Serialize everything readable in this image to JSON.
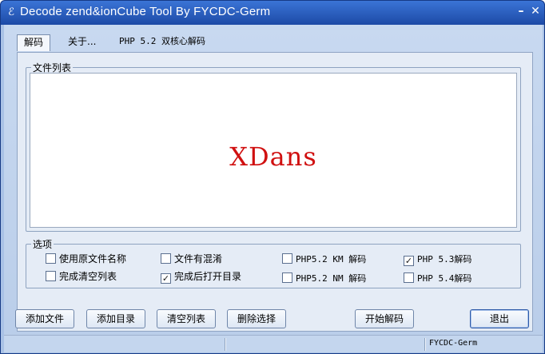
{
  "window": {
    "title": "Decode zend&ionCube Tool By FYCDC-Germ",
    "icon": "app-icon",
    "min_glyph": "–",
    "close_glyph": "✕"
  },
  "tabs": [
    {
      "label": "解码",
      "active": true
    },
    {
      "label": "关于..."
    },
    {
      "label": "PHP 5.2 双核心解码"
    }
  ],
  "file_list": {
    "legend": "文件列表",
    "watermark": "XDans"
  },
  "options": {
    "legend": "选项",
    "items": [
      {
        "label": "使用原文件名称",
        "checked": false
      },
      {
        "label": "完成清空列表",
        "checked": false
      },
      {
        "label": "文件有混淆",
        "checked": false
      },
      {
        "label": "完成后打开目录",
        "checked": true
      },
      {
        "label": "PHP5.2 KM 解码",
        "checked": false
      },
      {
        "label": "PHP5.2 NM 解码",
        "checked": false
      },
      {
        "label": "PHP 5.3解码",
        "checked": true
      },
      {
        "label": "PHP 5.4解码",
        "checked": false
      }
    ]
  },
  "buttons": {
    "add_file": "添加文件",
    "add_dir": "添加目录",
    "clear_list": "清空列表",
    "delete_sel": "删除选择",
    "start_decode": "开始解码",
    "exit": "退出"
  },
  "status": {
    "right_text": "FYCDC-Germ"
  }
}
